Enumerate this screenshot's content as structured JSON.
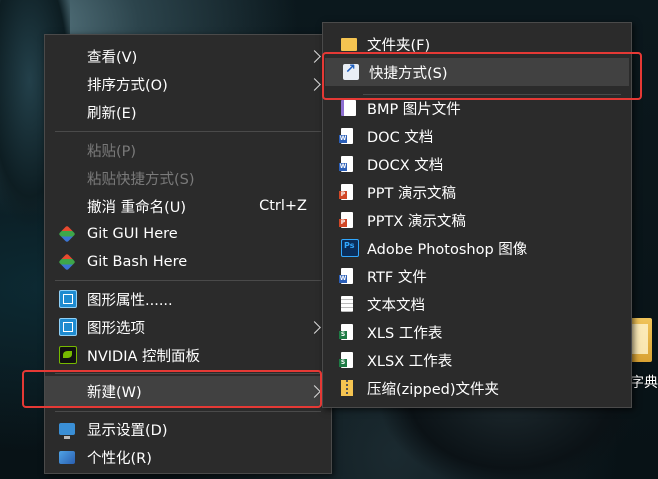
{
  "desktop": {
    "visible_icon_label": "字典"
  },
  "context_menu": {
    "items": [
      {
        "label": "查看(V)",
        "submenu": true
      },
      {
        "label": "排序方式(O)",
        "submenu": true
      },
      {
        "label": "刷新(E)"
      },
      {
        "label": "粘贴(P)",
        "disabled": true
      },
      {
        "label": "粘贴快捷方式(S)",
        "disabled": true
      },
      {
        "label": "撤消 重命名(U)",
        "accelerator": "Ctrl+Z"
      },
      {
        "label": "Git GUI Here",
        "icon": "git-gui-icon"
      },
      {
        "label": "Git Bash Here",
        "icon": "git-bash-icon"
      },
      {
        "label": "图形属性......",
        "icon": "intel-graphics-icon"
      },
      {
        "label": "图形选项",
        "icon": "intel-graphics-icon",
        "submenu": true
      },
      {
        "label": "NVIDIA 控制面板",
        "icon": "nvidia-icon"
      },
      {
        "label": "新建(W)",
        "submenu": true,
        "highlighted": true
      },
      {
        "label": "显示设置(D)",
        "icon": "display-icon"
      },
      {
        "label": "个性化(R)",
        "icon": "personalize-icon"
      }
    ]
  },
  "new_submenu": {
    "items": [
      {
        "label": "文件夹(F)",
        "icon": "folder-icon"
      },
      {
        "label": "快捷方式(S)",
        "icon": "shortcut-icon",
        "highlighted": true
      },
      {
        "label": "BMP 图片文件",
        "icon": "bmp-file-icon"
      },
      {
        "label": "DOC 文档",
        "icon": "word-doc-icon"
      },
      {
        "label": "DOCX 文档",
        "icon": "word-docx-icon"
      },
      {
        "label": "PPT 演示文稿",
        "icon": "ppt-file-icon"
      },
      {
        "label": "PPTX 演示文稿",
        "icon": "pptx-file-icon"
      },
      {
        "label": "Adobe Photoshop 图像",
        "icon": "photoshop-icon"
      },
      {
        "label": "RTF 文件",
        "icon": "rtf-file-icon"
      },
      {
        "label": "文本文档",
        "icon": "text-file-icon"
      },
      {
        "label": "XLS 工作表",
        "icon": "xls-file-icon"
      },
      {
        "label": "XLSX 工作表",
        "icon": "xlsx-file-icon"
      },
      {
        "label": "压缩(zipped)文件夹",
        "icon": "zip-folder-icon"
      }
    ]
  },
  "colors": {
    "menu_bg": "#2b2b2b",
    "menu_highlight": "#414141",
    "annotation_red": "#e53935",
    "disabled_text": "#7a7a7a"
  }
}
